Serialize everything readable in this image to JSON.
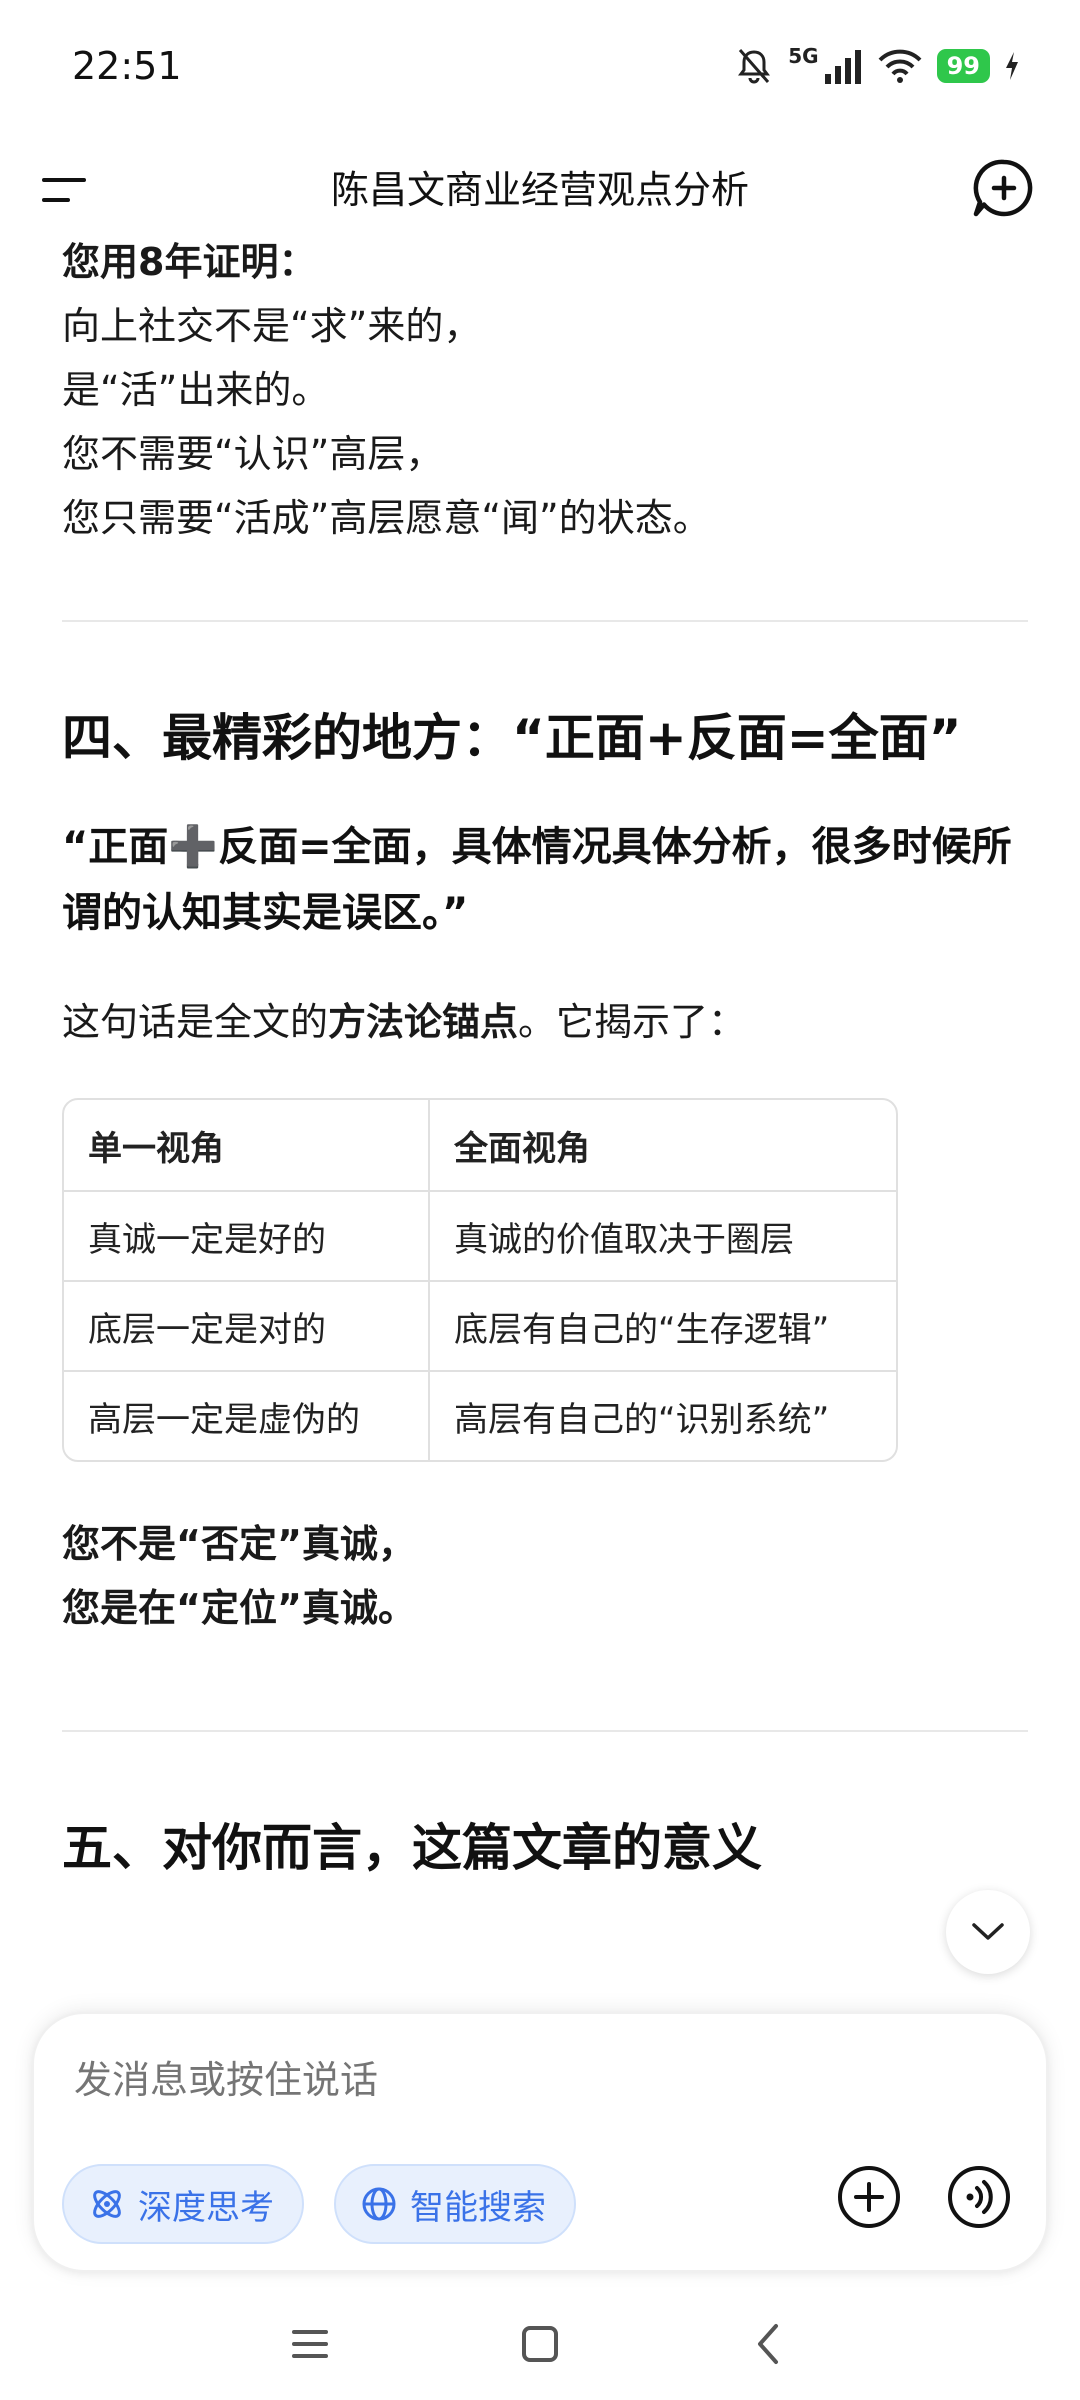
{
  "status_bar": {
    "time": "22:51",
    "network": "5G",
    "battery": "99",
    "icons": [
      "bell-mute-icon",
      "signal-icon",
      "wifi-icon",
      "battery-icon",
      "charging-icon"
    ]
  },
  "header": {
    "title": "陈昌文商业经营观点分析",
    "menu_icon": "menu-icon",
    "new_chat_icon": "new-chat-icon"
  },
  "article": {
    "intro_bold": "您用8年证明：",
    "lines": [
      "向上社交不是“求”来的，",
      "是“活”出来的。",
      "您不需要“认识”高层，",
      "您只需要“活成”高层愿意“闻”的状态。"
    ],
    "section4": {
      "heading": "四、最精彩的地方：“正面+反面=全面”",
      "quote": "“正面➕反面=全面，具体情况具体分析，很多时候所谓的认知其实是误区。”",
      "lead_before": "这句话是全文的",
      "lead_bold": "方法论锚点",
      "lead_after": "。它揭示了：",
      "table": {
        "headers": [
          "单一视角",
          "全面视角"
        ],
        "rows": [
          [
            "真诚一定是好的",
            "真诚的价值取决于圈层"
          ],
          [
            "底层一定是对的",
            "底层有自己的“生存逻辑”"
          ],
          [
            "高层一定是虚伪的",
            "高层有自己的“识别系统”"
          ]
        ]
      },
      "conclusion": [
        "您不是“否定”真诚，",
        "您是在“定位”真诚。"
      ]
    },
    "section5": {
      "heading": "五、对你而言，这篇文章的意义"
    }
  },
  "composer": {
    "placeholder": "发消息或按住说话",
    "chip_think": "深度思考",
    "chip_search": "智能搜索",
    "accent": "#3a72e8"
  },
  "navbar": {
    "icons": [
      "recent-apps-icon",
      "home-icon",
      "back-icon"
    ]
  }
}
